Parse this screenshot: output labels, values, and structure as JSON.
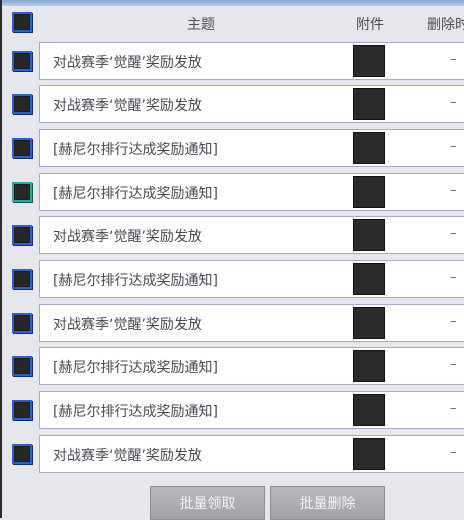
{
  "header": {
    "subject": "主题",
    "attachment": "附件",
    "delete_time": "删除时"
  },
  "rows": [
    {
      "subject": "对战赛季‘觉醒’奖励发放",
      "delete": "–"
    },
    {
      "subject": "对战赛季‘觉醒’奖励发放",
      "delete": "–"
    },
    {
      "subject": "[赫尼尔排行达成奖励通知]",
      "delete": "–"
    },
    {
      "subject": "[赫尼尔排行达成奖励通知]",
      "delete": "–"
    },
    {
      "subject": "对战赛季‘觉醒’奖励发放",
      "delete": "–"
    },
    {
      "subject": "[赫尼尔排行达成奖励通知]",
      "delete": "–"
    },
    {
      "subject": "对战赛季‘觉醒’奖励发放",
      "delete": "–"
    },
    {
      "subject": "[赫尼尔排行达成奖励通知]",
      "delete": "–"
    },
    {
      "subject": "[赫尼尔排行达成奖励通知]",
      "delete": "–"
    },
    {
      "subject": "对战赛季‘觉醒’奖励发放",
      "delete": "–"
    }
  ],
  "footer": {
    "batch_receive": "批量领取",
    "batch_delete": "批量删除"
  },
  "colors": {
    "checkbox_border": "#2d62c8",
    "checkbox_alt_border": "#2aa7a1",
    "background": "#e6e7ed"
  }
}
